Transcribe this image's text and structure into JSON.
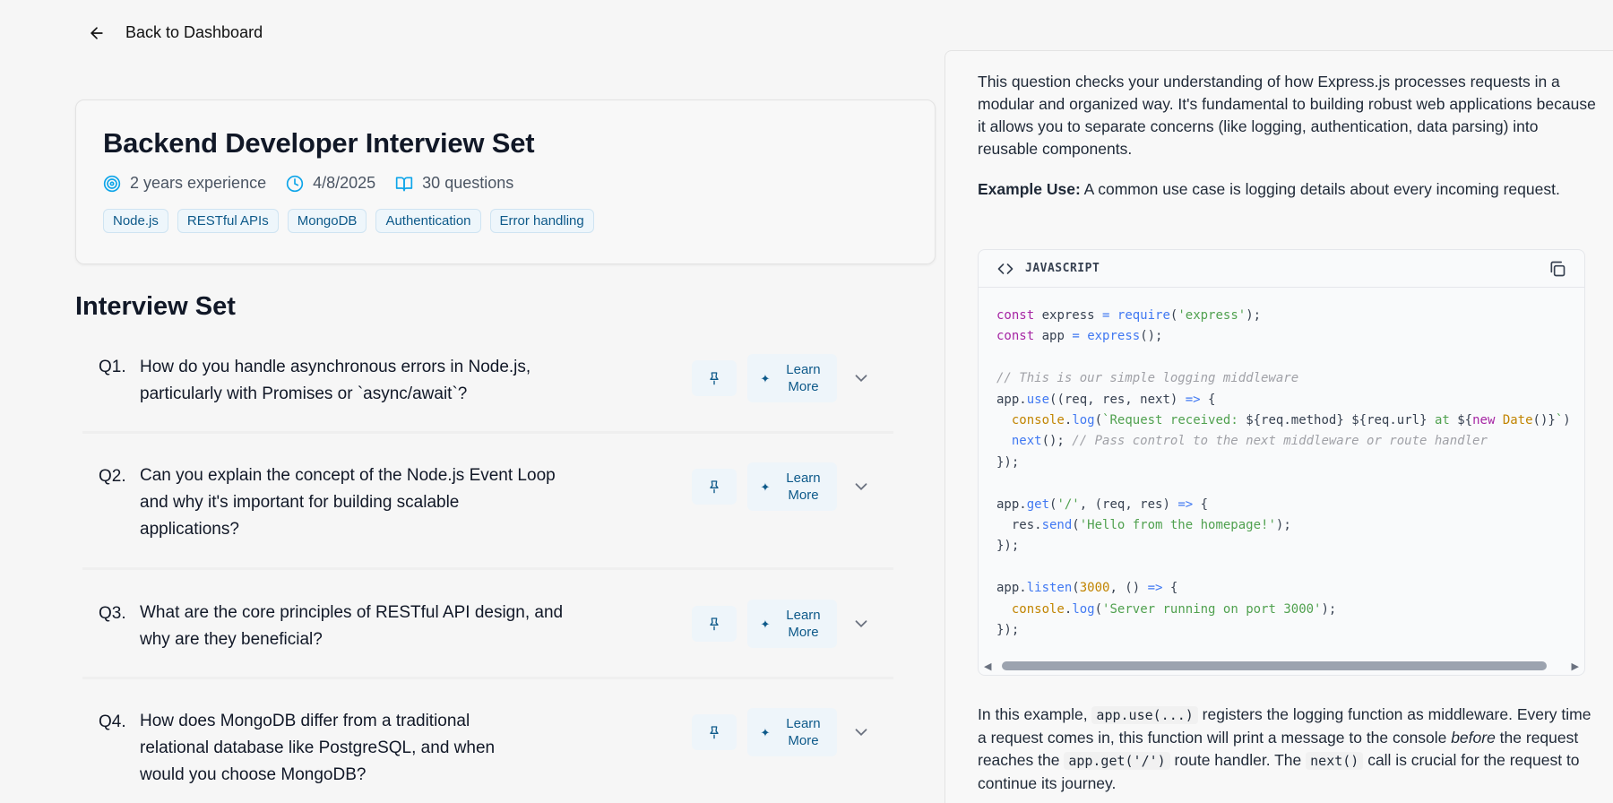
{
  "back": {
    "label": "Back to Dashboard"
  },
  "header": {
    "title": "Backend Developer Interview Set",
    "experience": "2 years experience",
    "date": "4/8/2025",
    "questions_count": "30 questions",
    "tags": [
      "Node.js",
      "RESTful APIs",
      "MongoDB",
      "Authentication",
      "Error handling"
    ]
  },
  "section_title": "Interview Set",
  "questions": [
    {
      "num": "Q1.",
      "text": "How do you handle asynchronous errors in Node.js, particularly with Promises or `async/await`?"
    },
    {
      "num": "Q2.",
      "text": "Can you explain the concept of the Node.js Event Loop and why it's important for building scalable applications?"
    },
    {
      "num": "Q3.",
      "text": "What are the core principles of RESTful API design, and why are they beneficial?"
    },
    {
      "num": "Q4.",
      "text": "How does MongoDB differ from a traditional relational database like PostgreSQL, and when would you choose MongoDB?"
    }
  ],
  "learn_more_label": "Learn More",
  "panel": {
    "intro": "This question checks your understanding of how Express.js processes requests in a modular and organized way. It's fundamental to building robust web applications because it allows you to separate concerns (like logging, authentication, data parsing) into reusable components.",
    "example_label": "Example Use:",
    "example_text": " A common use case is logging details about every incoming request.",
    "code_lang": "JAVASCRIPT",
    "explain_1": "In this example, ",
    "explain_code_1": "app.use(...)",
    "explain_2": " registers the logging function as middleware. Every time a request comes in, this function will print a message to the console ",
    "explain_em": "before",
    "explain_3": " the request reaches the ",
    "explain_code_2": "app.get('/')",
    "explain_4": " route handler. The ",
    "explain_code_3": "next()",
    "explain_5": " call is crucial for the request to continue its journey."
  },
  "colors": {
    "accent": "#0e5a8a",
    "tag_bg": "#eef6fb",
    "button_bg": "#eef5fa"
  },
  "icons": {
    "back": "arrow-left-icon",
    "experience": "target-icon",
    "date": "clock-icon",
    "questions": "book-open-icon",
    "pin": "pin-icon",
    "learn": "sparkle-icon",
    "expand": "chevron-down-icon",
    "code": "code-icon",
    "copy": "copy-icon"
  }
}
